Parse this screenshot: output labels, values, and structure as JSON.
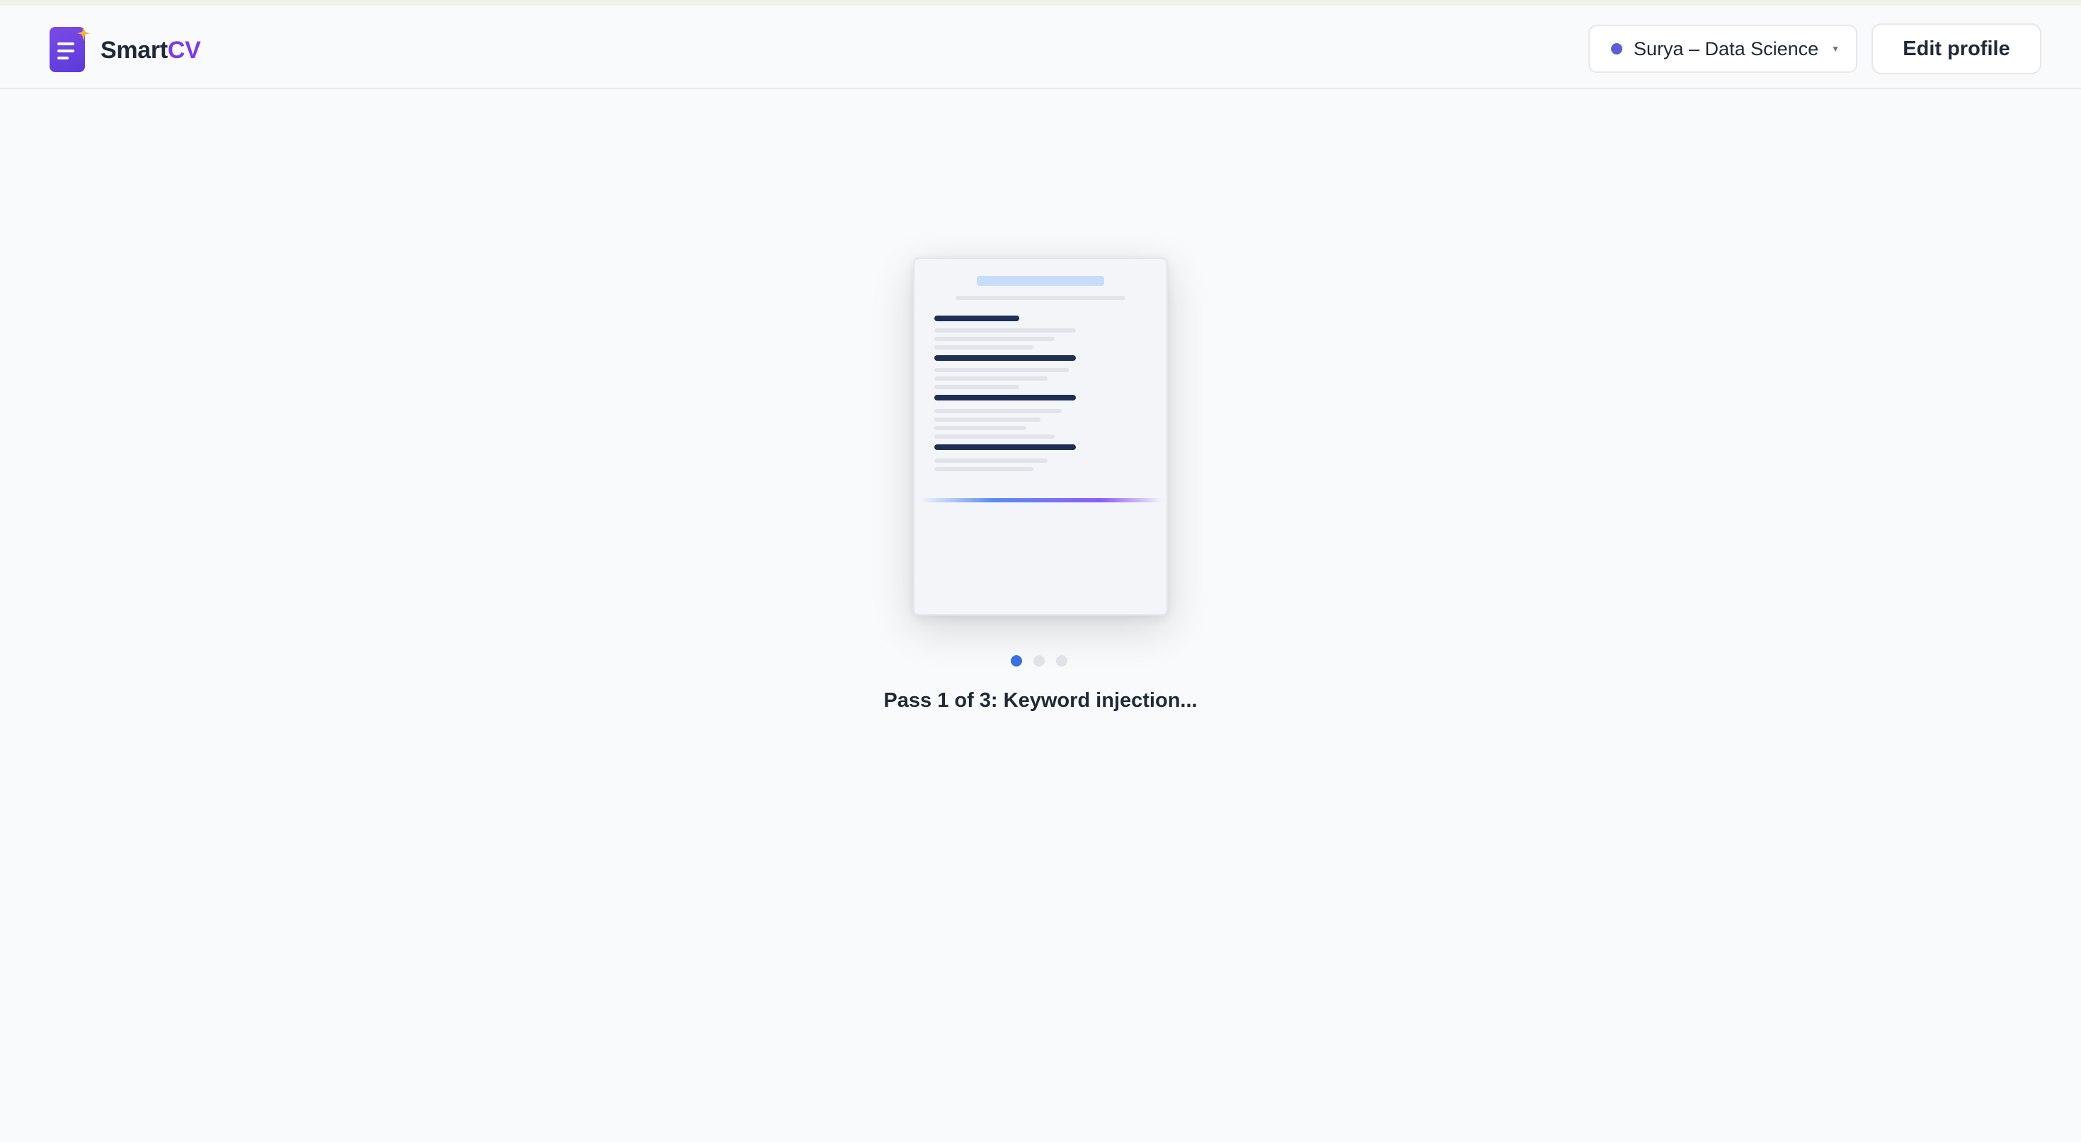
{
  "app": {
    "brand_primary": "Smart",
    "brand_accent": "CV",
    "brand_accent_color": "#7c3aed",
    "logo_icon": "document-sparkle-icon"
  },
  "header": {
    "profile_selector": {
      "label": "Surya – Data Science",
      "status_dot_color": "#5b5fd6",
      "icon": "chevron-down-icon"
    },
    "edit_profile_label": "Edit profile"
  },
  "main": {
    "preview_icon": "resume-document-icon",
    "progress": {
      "current_pass": 1,
      "total_passes": 3,
      "active_color": "#3b6fe0"
    },
    "status_text": "Pass 1 of 3: Keyword injection..."
  }
}
